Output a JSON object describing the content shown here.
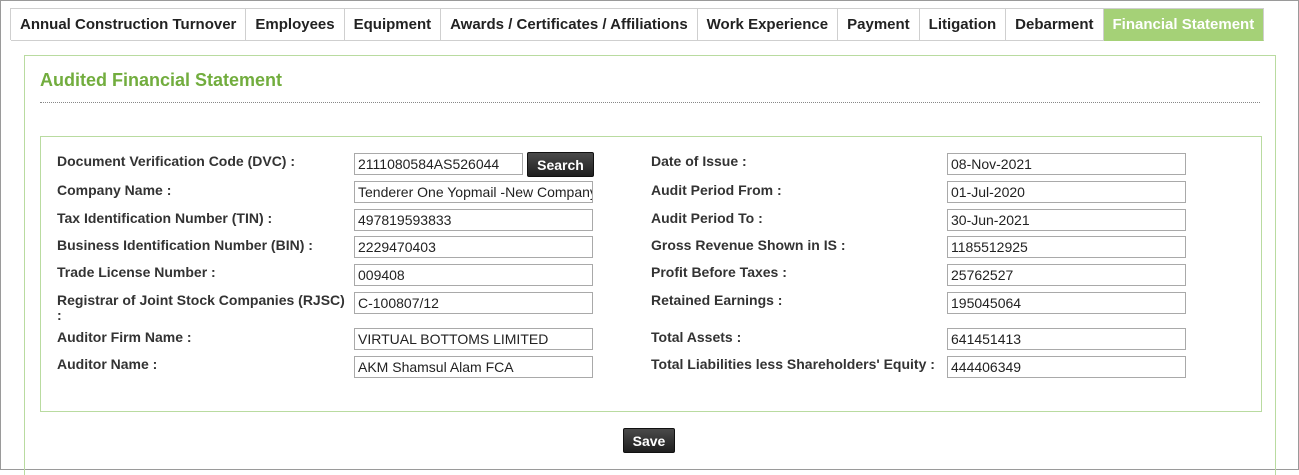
{
  "tabs": [
    {
      "label": "Annual Construction Turnover",
      "active": false
    },
    {
      "label": "Employees",
      "active": false
    },
    {
      "label": "Equipment",
      "active": false
    },
    {
      "label": "Awards / Certificates / Affiliations",
      "active": false
    },
    {
      "label": "Work Experience",
      "active": false
    },
    {
      "label": "Payment",
      "active": false
    },
    {
      "label": "Litigation",
      "active": false
    },
    {
      "label": "Debarment",
      "active": false
    },
    {
      "label": "Financial Statement",
      "active": true
    }
  ],
  "section": {
    "title": "Audited Financial Statement"
  },
  "form": {
    "dvc_label": "Document Verification Code (DVC) :",
    "dvc_value": "2111080584AS526044",
    "search_label": "Search",
    "company_label": "Company Name :",
    "company_value": "Tenderer One Yopmail -New Company",
    "tin_label": "Tax Identification Number (TIN) :",
    "tin_value": "497819593833",
    "bin_label": "Business Identification Number (BIN) :",
    "bin_value": "2229470403",
    "trade_label": "Trade License Number :",
    "trade_value": "009408",
    "rjsc_label": "Registrar of Joint Stock Companies (RJSC)",
    "rjsc_label_cont": ":",
    "rjsc_value": "C-100807/12",
    "auditor_firm_label": "Auditor Firm Name :",
    "auditor_firm_value": "VIRTUAL BOTTOMS LIMITED",
    "auditor_name_label": "Auditor Name :",
    "auditor_name_value": "AKM Shamsul Alam FCA",
    "issue_label": "Date of Issue :",
    "issue_value": "08-Nov-2021",
    "period_from_label": "Audit Period From :",
    "period_from_value": "01-Jul-2020",
    "period_to_label": "Audit Period To :",
    "period_to_value": "30-Jun-2021",
    "gross_label": "Gross Revenue Shown in IS :",
    "gross_value": "1185512925",
    "profit_label": "Profit Before Taxes :",
    "profit_value": "25762527",
    "retained_label": "Retained Earnings :",
    "retained_value": "195045064",
    "assets_label": "Total Assets :",
    "assets_value": "641451413",
    "liabilities_label": "Total Liabilities less Shareholders' Equity :",
    "liabilities_value": "444406349"
  },
  "save_label": "Save"
}
